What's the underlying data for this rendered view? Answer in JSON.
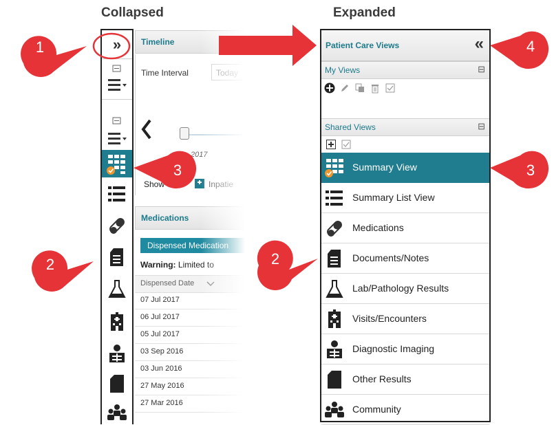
{
  "headings": {
    "collapsed": "Collapsed",
    "expanded": "Expanded"
  },
  "callouts": [
    "1",
    "2",
    "3",
    "4",
    "2",
    "3"
  ],
  "colors": {
    "teal": "#1f7d8f",
    "callout_red": "#e53338",
    "check_orange": "#f0962e"
  },
  "collapsed_bar": {
    "expand_glyph": "»",
    "icons": [
      "collapse-section-icon",
      "view-menu-icon",
      "collapse-section-icon",
      "view-menu-icon",
      "summary-view-icon",
      "summary-list-icon",
      "medications-icon",
      "documents-icon",
      "lab-icon",
      "visits-icon",
      "diagnostic-imaging-icon",
      "other-results-icon",
      "community-icon"
    ]
  },
  "timeline": {
    "title": "Timeline",
    "time_interval_label": "Time Interval",
    "time_interval_value": "Today",
    "date_fragment": "2017",
    "show_label": "Show",
    "inpatient_label": "Inpatie"
  },
  "medications": {
    "title": "Medications",
    "tab_label": "Dispensed Medication",
    "warning_bold": "Warning:",
    "warning_text": "Limited to",
    "column_header": "Dispensed Date",
    "rows": [
      "07 Jul 2017",
      "06 Jul 2017",
      "05 Jul 2017",
      "03 Sep 2016",
      "03 Jun 2016",
      "27 May 2016",
      "27 Mar 2016"
    ]
  },
  "expanded": {
    "title": "Patient Care Views",
    "collapse_glyph": "«",
    "my_views_label": "My Views",
    "shared_views_label": "Shared Views",
    "section_toggle": "⊟",
    "items": [
      {
        "label": "Summary View",
        "icon": "summary-view-icon",
        "selected": true
      },
      {
        "label": "Summary List View",
        "icon": "summary-list-icon",
        "selected": false
      },
      {
        "label": "Medications",
        "icon": "medications-icon",
        "selected": false
      },
      {
        "label": "Documents/Notes",
        "icon": "documents-icon",
        "selected": false
      },
      {
        "label": "Lab/Pathology Results",
        "icon": "lab-icon",
        "selected": false
      },
      {
        "label": "Visits/Encounters",
        "icon": "visits-icon",
        "selected": false
      },
      {
        "label": "Diagnostic Imaging",
        "icon": "diagnostic-imaging-icon",
        "selected": false
      },
      {
        "label": "Other Results",
        "icon": "other-results-icon",
        "selected": false
      },
      {
        "label": "Community",
        "icon": "community-icon",
        "selected": false
      }
    ]
  }
}
